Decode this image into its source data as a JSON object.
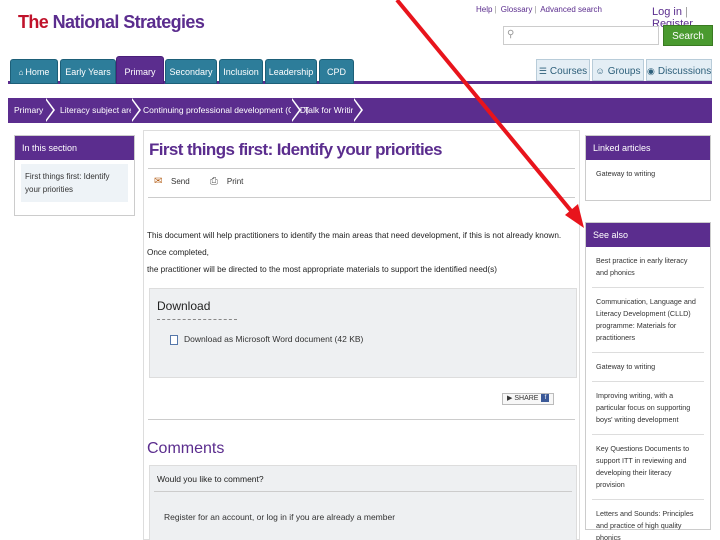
{
  "header": {
    "logo_the": "The",
    "logo_rest": "National Strategies",
    "util_links": [
      "Help",
      "Glossary",
      "Advanced search"
    ],
    "login": "Log in",
    "register": "Register",
    "search_placeholder": "",
    "search_button": "Search"
  },
  "nav": {
    "tabs": [
      {
        "label": "Home",
        "active": false
      },
      {
        "label": "Early Years",
        "active": false
      },
      {
        "label": "Primary",
        "active": true
      },
      {
        "label": "Secondary",
        "active": false
      },
      {
        "label": "Inclusion",
        "active": false
      },
      {
        "label": "Leadership",
        "active": false
      },
      {
        "label": "CPD",
        "active": false
      }
    ],
    "right_tabs": [
      {
        "label": "Courses",
        "icon": "courses-icon"
      },
      {
        "label": "Groups",
        "icon": "groups-icon"
      },
      {
        "label": "Discussions",
        "icon": "discussions-icon"
      }
    ]
  },
  "breadcrumb": [
    "Primary",
    "Literacy subject area",
    "Continuing professional development (CPD)",
    "Talk for Writing"
  ],
  "left": {
    "heading": "In this section",
    "link": "First things first: Identify your priorities"
  },
  "main": {
    "title": "First things first: Identify your priorities",
    "send": "Send",
    "print": "Print",
    "body_line1": "This document will help practitioners to identify the main areas that need development, if this is not already known. Once completed,",
    "body_line2": "the practitioner will be directed to the most appropriate materials to support the identified need(s)",
    "download_title": "Download",
    "download_link": "Download as Microsoft Word document (42 KB)",
    "share_label": "SHARE",
    "comments_title": "Comments",
    "comments_question": "Would you like to comment?",
    "comments_register": "Register for an account, or log in if you are already a member"
  },
  "right": {
    "linked_heading": "Linked articles",
    "linked_items": [
      "Gateway to writing"
    ],
    "see_also_heading": "See also",
    "see_also_items": [
      "Best practice in early literacy and phonics",
      "Communication, Language and Literacy Development (CLLD) programme: Materials for practitioners",
      "Gateway to writing",
      "Improving writing, with a particular focus on supporting boys' writing development",
      "Key Questions Documents to support ITT in reviewing and developing their literacy provision",
      "Letters and Sounds: Principles and practice of high quality phonics"
    ]
  },
  "colors": {
    "purple": "#5b2d8e",
    "teal": "#2d7d9a",
    "green": "#4a9a2f",
    "arrow_red": "#e8141c"
  }
}
